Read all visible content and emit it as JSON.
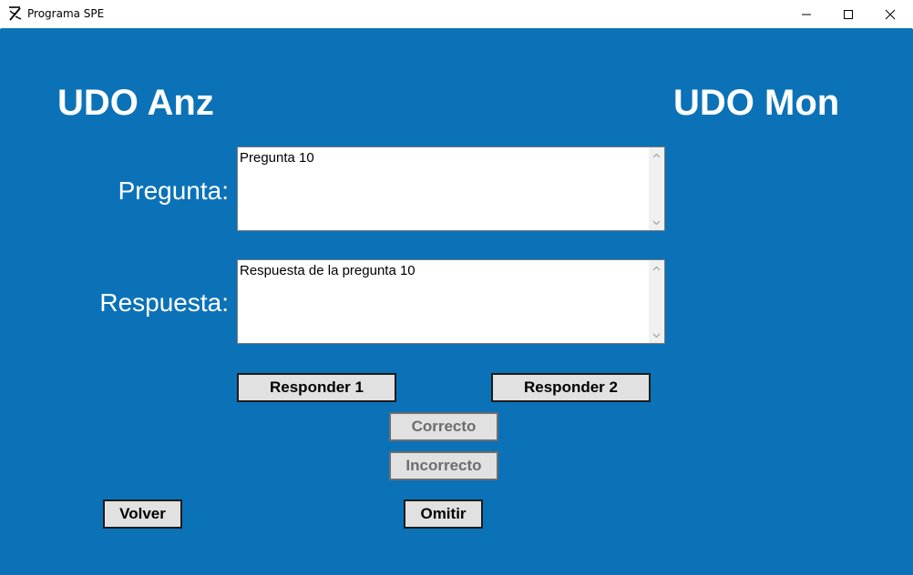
{
  "window": {
    "title": "Programa SPE",
    "controls": {
      "minimize": "minimize-icon",
      "maximize": "maximize-icon",
      "close": "close-icon"
    }
  },
  "header": {
    "left_team": "UDO Anz",
    "right_team": "UDO Mon"
  },
  "form": {
    "question_label": "Pregunta:",
    "question_value": "Pregunta 10",
    "answer_label": "Respuesta:",
    "answer_value": "Respuesta de la pregunta 10"
  },
  "buttons": {
    "respond_1": "Responder 1",
    "respond_2": "Responder 2",
    "correct": "Correcto",
    "incorrect": "Incorrecto",
    "back": "Volver",
    "skip": "Omitir"
  },
  "colors": {
    "background": "#0b72b8",
    "button_face": "#e1e1e1",
    "disabled_text": "#6d6d6d"
  }
}
